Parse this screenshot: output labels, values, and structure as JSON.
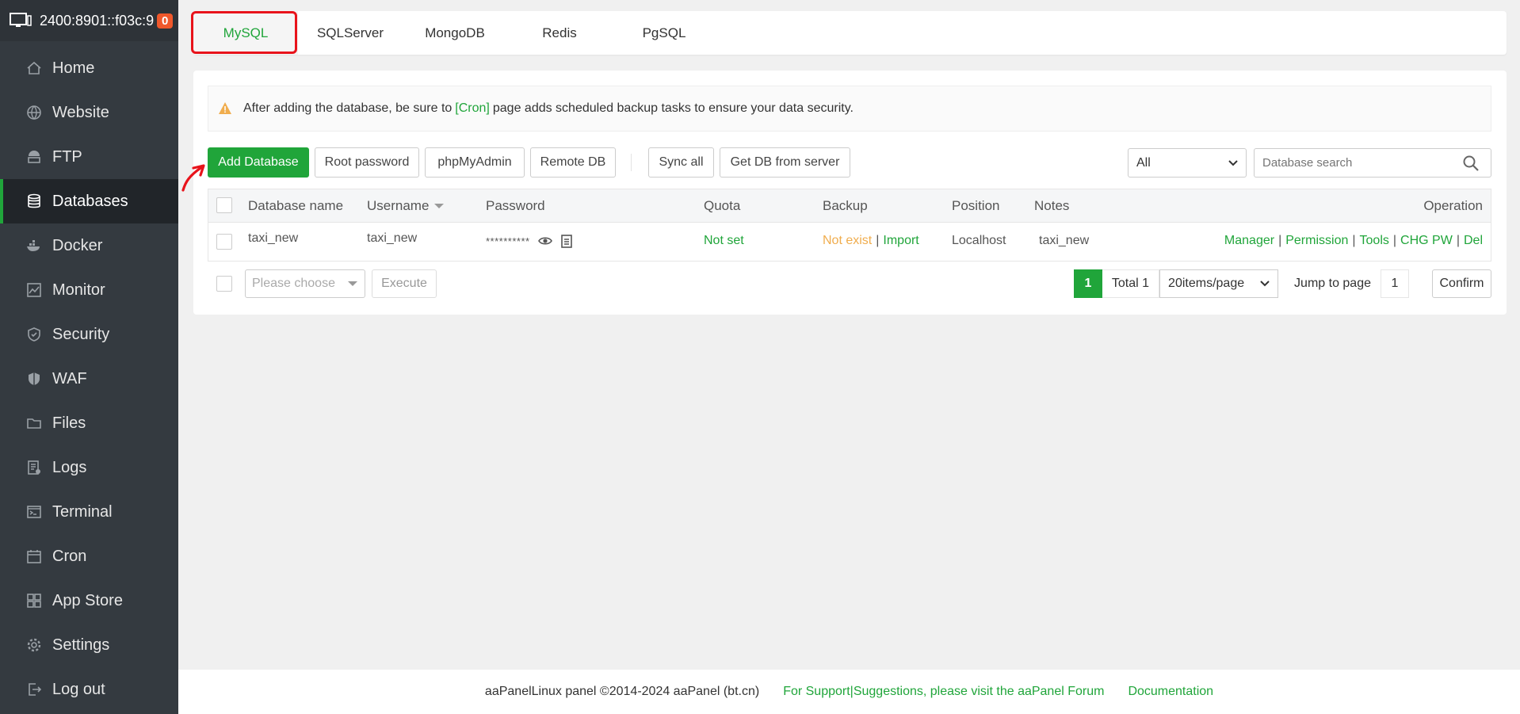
{
  "server": {
    "ip": "2400:8901::f03c:9",
    "badge": "0"
  },
  "sidebar": {
    "items": [
      {
        "label": "Home",
        "icon": "home-icon"
      },
      {
        "label": "Website",
        "icon": "globe-icon"
      },
      {
        "label": "FTP",
        "icon": "ftp-icon"
      },
      {
        "label": "Databases",
        "icon": "database-icon"
      },
      {
        "label": "Docker",
        "icon": "docker-icon"
      },
      {
        "label": "Monitor",
        "icon": "monitor-icon"
      },
      {
        "label": "Security",
        "icon": "shield-icon"
      },
      {
        "label": "WAF",
        "icon": "waf-shield-icon"
      },
      {
        "label": "Files",
        "icon": "folder-icon"
      },
      {
        "label": "Logs",
        "icon": "logs-icon"
      },
      {
        "label": "Terminal",
        "icon": "terminal-icon"
      },
      {
        "label": "Cron",
        "icon": "calendar-icon"
      },
      {
        "label": "App Store",
        "icon": "grid-icon"
      },
      {
        "label": "Settings",
        "icon": "gear-icon"
      },
      {
        "label": "Log out",
        "icon": "logout-icon"
      }
    ],
    "active": "Databases"
  },
  "tabs": [
    {
      "label": "MySQL"
    },
    {
      "label": "SQLServer"
    },
    {
      "label": "MongoDB"
    },
    {
      "label": "Redis"
    },
    {
      "label": "PgSQL"
    }
  ],
  "alert": {
    "prefix": "After adding the database, be sure to",
    "link": "[Cron]",
    "suffix": "page adds scheduled backup tasks to ensure your data security."
  },
  "toolbar": {
    "add_database": "Add Database",
    "root_password": "Root password",
    "phpmyadmin": "phpMyAdmin",
    "remote_db": "Remote DB",
    "sync_all": "Sync all",
    "get_db": "Get DB from server",
    "filter_value": "All",
    "search_placeholder": "Database search"
  },
  "table": {
    "headers": {
      "name": "Database name",
      "username": "Username",
      "password": "Password",
      "quota": "Quota",
      "backup": "Backup",
      "position": "Position",
      "notes": "Notes",
      "operation": "Operation"
    },
    "rows": [
      {
        "name": "taxi_new",
        "username": "taxi_new",
        "password": "**********",
        "quota": "Not set",
        "backup_status": "Not exist",
        "backup_import": "Import",
        "position": "Localhost",
        "notes": "taxi_new",
        "ops": [
          "Manager",
          "Permission",
          "Tools",
          "CHG PW",
          "Del"
        ]
      }
    ]
  },
  "batch": {
    "placeholder": "Please choose",
    "execute": "Execute"
  },
  "pagination": {
    "current": "1",
    "total": "Total 1",
    "page_size": "20items/page",
    "jump_label": "Jump to page",
    "jump_value": "1",
    "confirm": "Confirm"
  },
  "footer": {
    "copyright": "aaPanelLinux panel ©2014-2024 aaPanel (bt.cn)",
    "support": "For Support|Suggestions, please visit the aaPanel Forum",
    "docs": "Documentation"
  },
  "colors": {
    "accent": "#20a53a",
    "sidebar": "#343a40",
    "warning": "#f0ad4e",
    "annotation": "#e8131b"
  }
}
